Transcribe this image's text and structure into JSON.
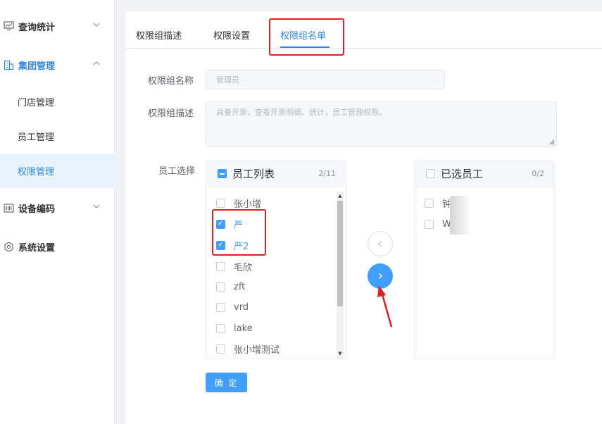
{
  "sidebar": {
    "menu": [
      {
        "label": "查询统计",
        "icon": "monitor-icon",
        "expanded": false
      },
      {
        "label": "集团管理",
        "icon": "building-icon",
        "expanded": true
      },
      {
        "label": "设备编码",
        "icon": "barcode-icon",
        "expanded": false
      },
      {
        "label": "系统设置",
        "icon": "gear-icon",
        "expanded": false
      }
    ],
    "submenu": [
      {
        "label": "门店管理",
        "active": false
      },
      {
        "label": "员工管理",
        "active": false
      },
      {
        "label": "权限管理",
        "active": true
      }
    ]
  },
  "tabs": [
    {
      "label": "权限组描述",
      "active": false
    },
    {
      "label": "权限设置",
      "active": false
    },
    {
      "label": "权限组名单",
      "active": true
    }
  ],
  "form": {
    "name_label": "权限组名称",
    "name_placeholder": "管理员",
    "desc_label": "权限组描述",
    "desc_placeholder": "具备开票，查看开票明细、统计，员工管理权限。",
    "staff_label": "员工选择"
  },
  "transfer": {
    "left": {
      "title": "员工列表",
      "count": "2/11",
      "items": [
        {
          "label": "张小增",
          "checked": false
        },
        {
          "label": "严",
          "checked": true
        },
        {
          "label": "严2",
          "checked": true
        },
        {
          "label": "毛欣",
          "checked": false
        },
        {
          "label": "zft",
          "checked": false
        },
        {
          "label": "vrd",
          "checked": false
        },
        {
          "label": "lake",
          "checked": false
        },
        {
          "label": "张小增测试",
          "checked": false
        }
      ]
    },
    "right": {
      "title": "已选员工",
      "count": "0/2",
      "items": [
        {
          "label": "钟",
          "checked": false
        },
        {
          "label": "W",
          "checked": false
        }
      ]
    }
  },
  "confirm_label": "确 定",
  "colors": {
    "primary": "#409eff",
    "active_text": "#2e86e6",
    "annotation_red": "#e02020"
  }
}
